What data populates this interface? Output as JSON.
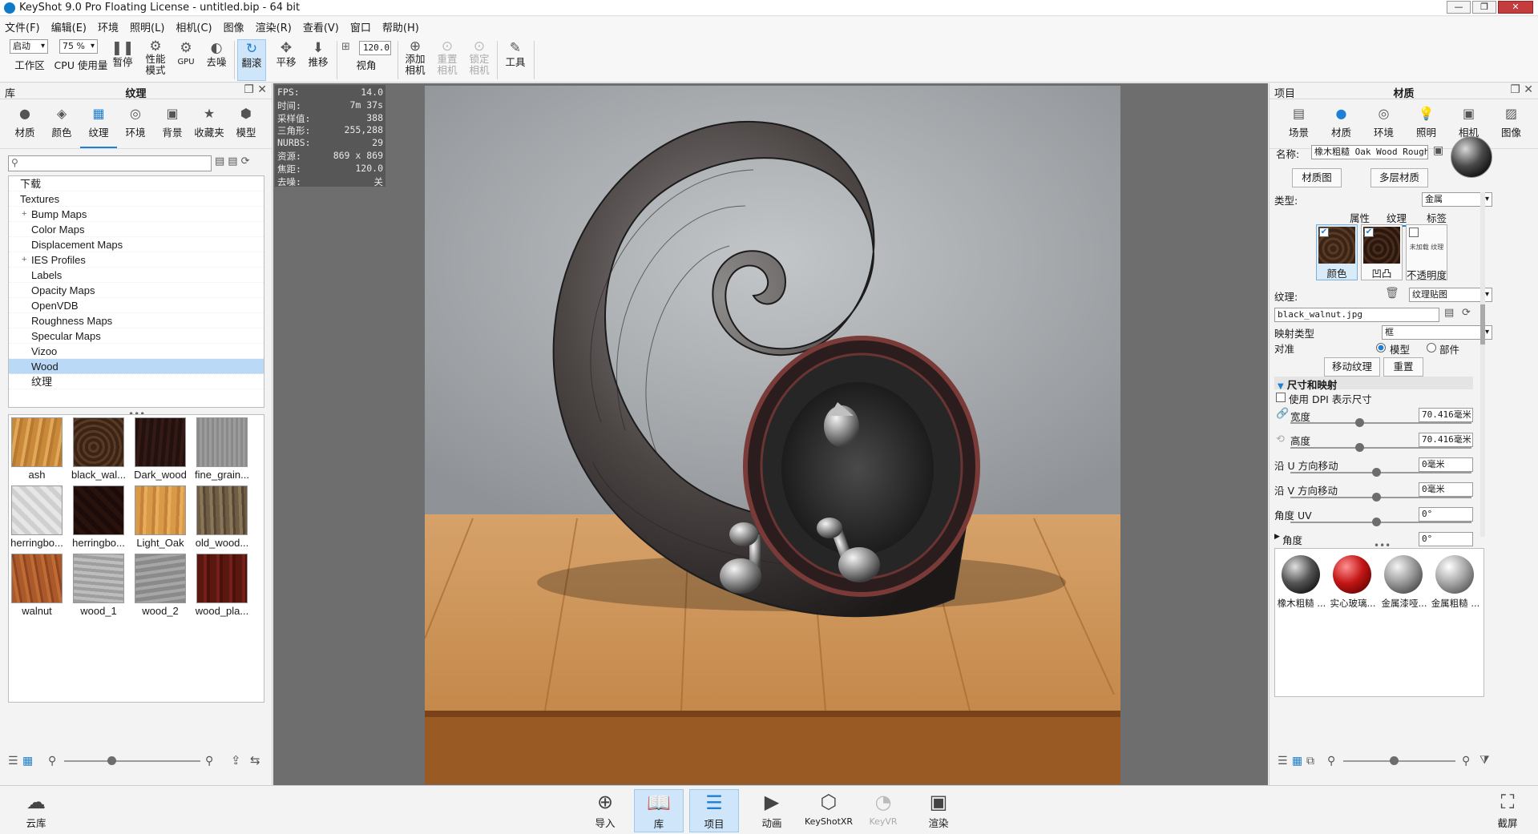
{
  "window": {
    "title": "KeyShot 9.0 Pro Floating License  - untitled.bip  - 64 bit",
    "buttons": [
      "—",
      "❐",
      "✕"
    ]
  },
  "menu": [
    "文件(F)",
    "编辑(E)",
    "环境",
    "照明(L)",
    "相机(C)",
    "图像",
    "渲染(R)",
    "查看(V)",
    "窗口",
    "帮助(H)"
  ],
  "toolbar": {
    "mode": "启动",
    "workspace": "工作区",
    "cpu_pct": "75 %",
    "cpu_usage": "CPU 使用量",
    "pause": "暂停",
    "perf": "性能\n模式",
    "gpu": "GPU",
    "denoise": "去噪",
    "tumble": "翻滚",
    "pan": "平移",
    "dolly": "推移",
    "fov_value": "120.0",
    "fov": "视角",
    "add_camera": "添加\n相机",
    "reset_camera": "重置\n相机",
    "lock_camera": "锁定\n相机",
    "tools": "工具"
  },
  "library": {
    "header": "库",
    "title": "纹理",
    "tabs": [
      "材质",
      "颜色",
      "纹理",
      "环境",
      "背景",
      "收藏夹",
      "模型"
    ],
    "search_placeholder": "",
    "tree": [
      "下载",
      "Textures",
      "Bump Maps",
      "Color Maps",
      "Displacement Maps",
      "IES Profiles",
      "Labels",
      "Opacity Maps",
      "OpenVDB",
      "Roughness Maps",
      "Specular Maps",
      "Vizoo",
      "Wood",
      "纹理"
    ],
    "thumbs": [
      {
        "name": "ash",
        "color": "#c8893b"
      },
      {
        "name": "black_wal...",
        "color": "#3a2416"
      },
      {
        "name": "Dark_wood",
        "color": "#231110"
      },
      {
        "name": "fine_grain...",
        "color": "#8a8a8a"
      },
      {
        "name": "herringbo...",
        "color": "#cfcfcf"
      },
      {
        "name": "herringbo...",
        "color": "#1c0b08"
      },
      {
        "name": "Light_Oak",
        "color": "#d89a47"
      },
      {
        "name": "old_wood...",
        "color": "#6e5c45"
      },
      {
        "name": "walnut",
        "color": "#a9592a"
      },
      {
        "name": "wood_1",
        "color": "#9e9e9e"
      },
      {
        "name": "wood_2",
        "color": "#8a8a8a"
      },
      {
        "name": "wood_pla...",
        "color": "#5a1710"
      }
    ]
  },
  "stats": [
    {
      "k": "FPS:",
      "v": "14.0"
    },
    {
      "k": "时间:",
      "v": "7m 37s"
    },
    {
      "k": "采样值:",
      "v": "388"
    },
    {
      "k": "三角形:",
      "v": "255,288"
    },
    {
      "k": "NURBS:",
      "v": "29"
    },
    {
      "k": "资源:",
      "v": "869 x 869"
    },
    {
      "k": "焦距:",
      "v": "120.0"
    },
    {
      "k": "去噪:",
      "v": "关"
    }
  ],
  "project": {
    "header": "项目",
    "title": "材质",
    "tabs": [
      "场景",
      "材质",
      "环境",
      "照明",
      "相机",
      "图像"
    ],
    "name_label": "名称:",
    "name_value": "橡木粗糙 Oak Wood Rough",
    "material_graph": "材质图",
    "multi_material": "多层材质",
    "type_label": "类型:",
    "type_value": "金属",
    "subtabs": [
      "属性",
      "纹理",
      "标签"
    ],
    "maps": [
      {
        "label": "颜色",
        "checked": true
      },
      {
        "label": "凹凸",
        "checked": true
      },
      {
        "label": "不透明度",
        "checked": false,
        "note": "未加载 纹理"
      }
    ],
    "texture_label": "纹理:",
    "texture_type": "纹理贴图",
    "file": "black_walnut.jpg",
    "mapping_label": "映射类型",
    "mapping_value": "框",
    "align_label": "对准",
    "align_model": "模型",
    "align_part": "部件",
    "move_texture": "移动纹理",
    "reset": "重置",
    "size_section": "尺寸和映射",
    "use_dpi": "使用 DPI 表示尺寸",
    "width_label": "宽度",
    "width_value": "70.416毫米",
    "height_label": "高度",
    "height_value": "70.416毫米",
    "u_label": "沿 U 方向移动",
    "u_value": "0毫米",
    "v_label": "沿 V 方向移动",
    "v_value": "0毫米",
    "uv_angle_label": "角度 UV",
    "uv_angle_value": "0°",
    "angle_label": "角度",
    "angle_value": "0°",
    "materials": [
      "橡木粗糙 ...",
      "实心玻璃...",
      "金属漆哑...",
      "金属粗糙 ..."
    ]
  },
  "bottom": {
    "cloud": "云库",
    "import": "导入",
    "library": "库",
    "project": "项目",
    "animation": "动画",
    "keyshotxr": "KeyShotXR",
    "keyvr": "KeyVR",
    "render": "渲染",
    "screenshot": "截屏"
  }
}
